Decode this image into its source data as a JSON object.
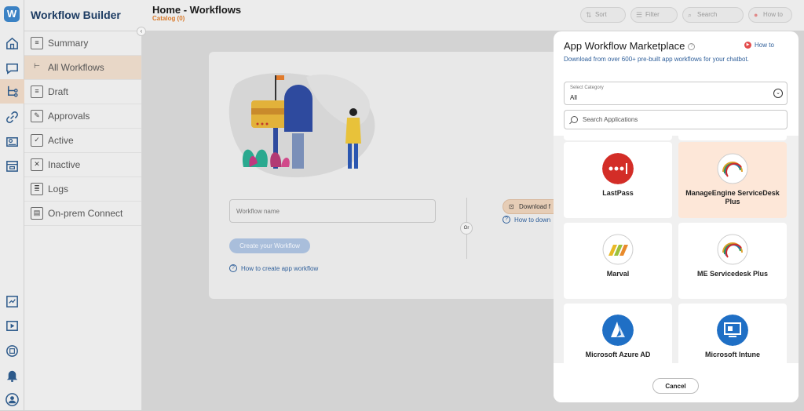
{
  "app": {
    "title": "Workflow Builder",
    "logo_letter": "W"
  },
  "header": {
    "title": "Home - Workflows",
    "catalog": "Catalog (0)"
  },
  "toolbar": {
    "sort_label": "Sort",
    "filter_label": "Filter",
    "search_placeholder": "Search",
    "howto_label": "How to"
  },
  "rail_icons": [
    "home-icon",
    "chat-icon",
    "workflow-icon",
    "link-icon",
    "dashboard-icon",
    "inbox-icon",
    "notes-icon",
    "video-icon",
    "help-icon",
    "bell-icon",
    "profile-icon"
  ],
  "sidebar": {
    "items": [
      {
        "label": "Summary",
        "icon": "summary-icon"
      },
      {
        "label": "All Workflows",
        "icon": "tree-icon"
      },
      {
        "label": "Draft",
        "icon": "draft-icon"
      },
      {
        "label": "Approvals",
        "icon": "approvals-icon"
      },
      {
        "label": "Active",
        "icon": "check-icon"
      },
      {
        "label": "Inactive",
        "icon": "x-icon"
      },
      {
        "label": "Logs",
        "icon": "logs-icon"
      },
      {
        "label": "On-prem Connect",
        "icon": "server-icon"
      }
    ],
    "active_index": 1
  },
  "main": {
    "workflow_name_placeholder": "Workflow name",
    "create_label": "Create your Workflow",
    "howto_create_label": "How to create app workflow",
    "or_label": "Or",
    "download_label": "Download f",
    "howto_download_label": "How to down"
  },
  "panel": {
    "title": "App Workflow Marketplace",
    "howto_label": "How to",
    "subtitle": "Download from over 600+ pre-built app workflows for your chatbot.",
    "category_label": "Select Category",
    "category_value": "All",
    "search_placeholder": "Search Applications",
    "apps": [
      {
        "name": "LastPass",
        "logo": "lastpass-logo",
        "highlighted": false
      },
      {
        "name": "ManageEngine ServiceDesk Plus",
        "logo": "manageengine-logo",
        "highlighted": true
      },
      {
        "name": "Marval",
        "logo": "marval-logo",
        "highlighted": false
      },
      {
        "name": "ME Servicedesk Plus",
        "logo": "manageengine-logo",
        "highlighted": false
      },
      {
        "name": "Microsoft Azure AD",
        "logo": "azure-logo",
        "highlighted": false
      },
      {
        "name": "Microsoft Intune",
        "logo": "intune-logo",
        "highlighted": false
      }
    ],
    "cancel_label": "Cancel"
  },
  "colors": {
    "accent": "#2f5f9a",
    "active_bg": "#e8d7c7",
    "overlay": "#d3d3d3"
  }
}
